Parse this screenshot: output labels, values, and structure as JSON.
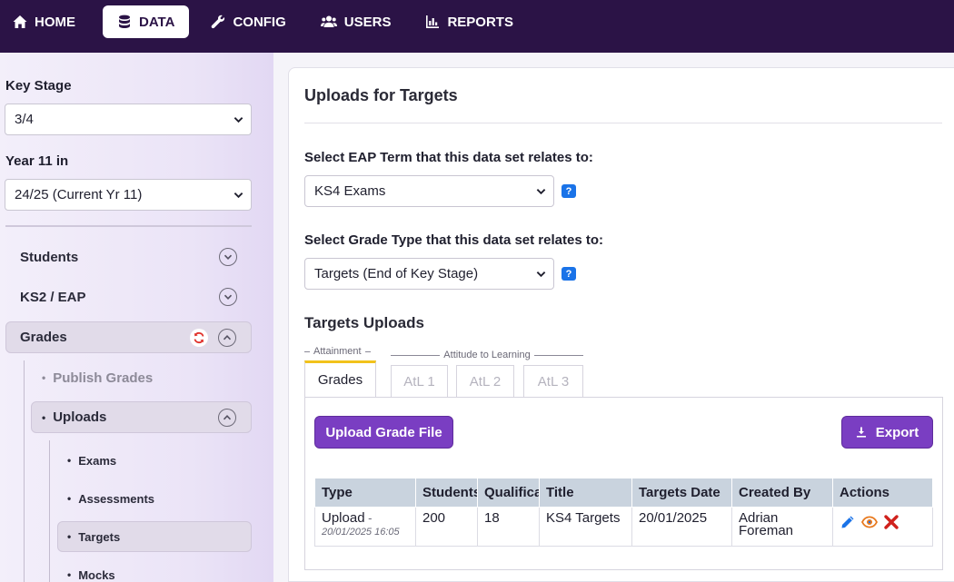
{
  "nav": {
    "items": [
      {
        "label": "HOME",
        "icon": "home-icon"
      },
      {
        "label": "DATA",
        "icon": "database-icon",
        "active": true
      },
      {
        "label": "CONFIG",
        "icon": "wrench-icon"
      },
      {
        "label": "USERS",
        "icon": "users-icon"
      },
      {
        "label": "REPORTS",
        "icon": "chart-bar-icon"
      }
    ]
  },
  "sidebar": {
    "key_stage_label": "Key Stage",
    "key_stage_value": "3/4",
    "year_label": "Year 11 in",
    "year_value": "24/25 (Current Yr 11)",
    "menu": {
      "students": "Students",
      "ks2_eap": "KS2 / EAP",
      "grades": "Grades",
      "publish_grades": "Publish Grades",
      "uploads": "Uploads",
      "exams": "Exams",
      "assessments": "Assessments",
      "targets": "Targets",
      "mocks": "Mocks"
    }
  },
  "main": {
    "title": "Uploads for Targets",
    "term_label": "Select EAP Term that this data set relates to:",
    "term_value": "KS4 Exams",
    "grade_type_label": "Select Grade Type that this data set relates to:",
    "grade_type_value": "Targets (End of Key Stage)",
    "help": "?",
    "section_title": "Targets Uploads",
    "tab_groups": {
      "attainment": "Attainment",
      "atl": "Attitude to Learning"
    },
    "tabs": [
      "Grades",
      "AtL 1",
      "AtL 2",
      "AtL 3"
    ],
    "upload_button": "Upload Grade File",
    "export_button": "Export",
    "table": {
      "headers": [
        "Type",
        "Students",
        "Qualifications",
        "Title",
        "Targets Date",
        "Created By",
        "Actions"
      ],
      "rows": [
        {
          "type": "Upload",
          "type_sep": " -",
          "type_date": "20/01/2025 16:05",
          "students": "200",
          "qualifications": "18",
          "title": "KS4 Targets",
          "date": "20/01/2025",
          "created_by": "Adrian Foreman"
        }
      ]
    }
  },
  "colors": {
    "nav_bg": "#2b1346",
    "accent_purple": "#7a3ec2",
    "tab_highlight": "#f2c21b",
    "help_blue": "#1a73e8",
    "edit_blue": "#1a73e8",
    "view_orange": "#e8791d",
    "delete_red": "#d0211c"
  }
}
